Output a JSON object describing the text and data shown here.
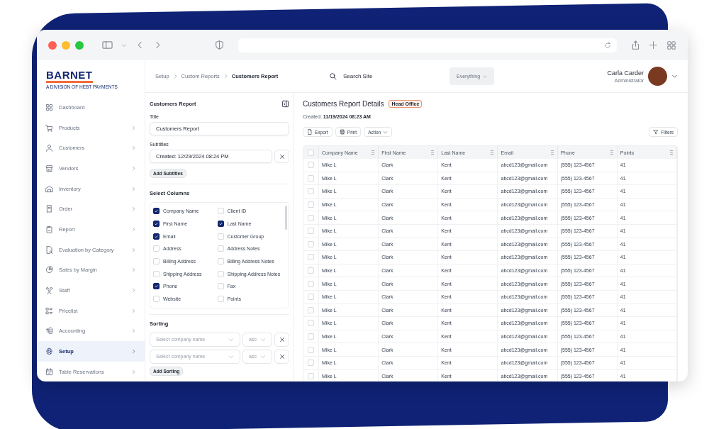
{
  "brand": {
    "name": "BARNET",
    "tagline": "A DIVISION OF HEBT PAYMENTS"
  },
  "sidebar": {
    "items": [
      {
        "label": "Dashboard",
        "expandable": false,
        "selected": false
      },
      {
        "label": "Products",
        "expandable": true,
        "selected": false
      },
      {
        "label": "Customers",
        "expandable": true,
        "selected": false
      },
      {
        "label": "Vendors",
        "expandable": true,
        "selected": false
      },
      {
        "label": "Inventory",
        "expandable": true,
        "selected": false
      },
      {
        "label": "Order",
        "expandable": true,
        "selected": false
      },
      {
        "label": "Report",
        "expandable": true,
        "selected": false
      },
      {
        "label": "Evaluation by Category",
        "expandable": true,
        "selected": false
      },
      {
        "label": "Sales by Margin",
        "expandable": true,
        "selected": false
      },
      {
        "label": "Staff",
        "expandable": true,
        "selected": false
      },
      {
        "label": "Pricelist",
        "expandable": true,
        "selected": false
      },
      {
        "label": "Accounting",
        "expandable": true,
        "selected": false
      },
      {
        "label": "Setup",
        "expandable": true,
        "selected": true
      },
      {
        "label": "Table Reservations",
        "expandable": true,
        "selected": false
      }
    ]
  },
  "breadcrumbs": [
    "Setup",
    "Custom Reports",
    "Customers Report"
  ],
  "search": {
    "placeholder": "Search Site",
    "scope": "Everything"
  },
  "user": {
    "name": "Carla Carder",
    "role": "Administrator"
  },
  "settings_panel": {
    "title": "Customers Report",
    "title_field": {
      "label": "Title",
      "value": "Customers Report"
    },
    "subtitles_field": {
      "label": "Subtitles",
      "value": "Created: 12/29/2024 08:24 PM"
    },
    "add_subtitles": "Add Subtitles",
    "columns_heading": "Select Columns",
    "columns": [
      {
        "label": "Company Name",
        "checked": true
      },
      {
        "label": "Client ID",
        "checked": false
      },
      {
        "label": "First Name",
        "checked": true
      },
      {
        "label": "Last Name",
        "checked": true
      },
      {
        "label": "Email",
        "checked": true
      },
      {
        "label": "Customer Group",
        "checked": false
      },
      {
        "label": "Address",
        "checked": false
      },
      {
        "label": "Address Notes",
        "checked": false
      },
      {
        "label": "Billing Address",
        "checked": false
      },
      {
        "label": "Billing Address Notes",
        "checked": false
      },
      {
        "label": "Shipping Address",
        "checked": false
      },
      {
        "label": "Shipping Address Notes",
        "checked": false
      },
      {
        "label": "Phone",
        "checked": true
      },
      {
        "label": "Fax",
        "checked": false
      },
      {
        "label": "Website",
        "checked": false
      },
      {
        "label": "Points",
        "checked": false
      }
    ],
    "sorting_heading": "Sorting",
    "sort_rows": [
      {
        "placeholder": "Select company name",
        "order": "asc"
      },
      {
        "placeholder": "Select company name",
        "order": "asc"
      }
    ],
    "add_sorting": "Add Sorting"
  },
  "report": {
    "title": "Customers Report Details",
    "badge": "Head Office",
    "created_label": "Created:",
    "created_value": "11/19/2024 08:23 AM",
    "actions": [
      "Export",
      "Print",
      "Action"
    ],
    "filters": "Filters",
    "table": {
      "all_selected": false,
      "columns": [
        "Company Name",
        "First Name",
        "Last Name",
        "Email",
        "Phone",
        "Points"
      ],
      "rows": [
        {
          "selected": false,
          "cells": [
            "Mike L",
            "Clark",
            "Kent",
            "abcd123@gmail.com",
            "(555) 123-4567",
            "41"
          ]
        },
        {
          "selected": false,
          "cells": [
            "Mike L",
            "Clark",
            "Kent",
            "abcd123@gmail.com",
            "(555) 123-4567",
            "41"
          ]
        },
        {
          "selected": false,
          "cells": [
            "Mike L",
            "Clark",
            "Kent",
            "abcd123@gmail.com",
            "(555) 123-4567",
            "41"
          ]
        },
        {
          "selected": false,
          "cells": [
            "Mike L",
            "Clark",
            "Kent",
            "abcd123@gmail.com",
            "(555) 123-4567",
            "41"
          ]
        },
        {
          "selected": false,
          "cells": [
            "Mike L",
            "Clark",
            "Kent",
            "abcd123@gmail.com",
            "(555) 123-4567",
            "41"
          ]
        },
        {
          "selected": false,
          "cells": [
            "Mike L",
            "Clark",
            "Kent",
            "abcd123@gmail.com",
            "(555) 123-4567",
            "41"
          ]
        },
        {
          "selected": false,
          "cells": [
            "Mike L",
            "Clark",
            "Kent",
            "abcd123@gmail.com",
            "(555) 123-4567",
            "41"
          ]
        },
        {
          "selected": false,
          "cells": [
            "Mike L",
            "Clark",
            "Kent",
            "abcd123@gmail.com",
            "(555) 123-4567",
            "41"
          ]
        },
        {
          "selected": false,
          "cells": [
            "Mike L",
            "Clark",
            "Kent",
            "abcd123@gmail.com",
            "(555) 123-4567",
            "41"
          ]
        },
        {
          "selected": false,
          "cells": [
            "Mike L",
            "Clark",
            "Kent",
            "abcd123@gmail.com",
            "(555) 123-4567",
            "41"
          ]
        },
        {
          "selected": false,
          "cells": [
            "Mike L",
            "Clark",
            "Kent",
            "abcd123@gmail.com",
            "(555) 123-4567",
            "41"
          ]
        },
        {
          "selected": false,
          "cells": [
            "Mike L",
            "Clark",
            "Kent",
            "abcd123@gmail.com",
            "(555) 123-4567",
            "41"
          ]
        },
        {
          "selected": false,
          "cells": [
            "Mike L",
            "Clark",
            "Kent",
            "abcd123@gmail.com",
            "(555) 123-4567",
            "41"
          ]
        },
        {
          "selected": false,
          "cells": [
            "Mike L",
            "Clark",
            "Kent",
            "abcd123@gmail.com",
            "(555) 123-4567",
            "41"
          ]
        },
        {
          "selected": false,
          "cells": [
            "Mike L",
            "Clark",
            "Kent",
            "abcd123@gmail.com",
            "(555) 123-4567",
            "41"
          ]
        },
        {
          "selected": false,
          "cells": [
            "Mike L",
            "Clark",
            "Kent",
            "abcd123@gmail.com",
            "(555) 123-4567",
            "41"
          ]
        },
        {
          "selected": false,
          "cells": [
            "Mike L",
            "Clark",
            "Kent",
            "abcd123@gmail.com",
            "(555) 123-4567",
            "41"
          ]
        }
      ]
    }
  }
}
